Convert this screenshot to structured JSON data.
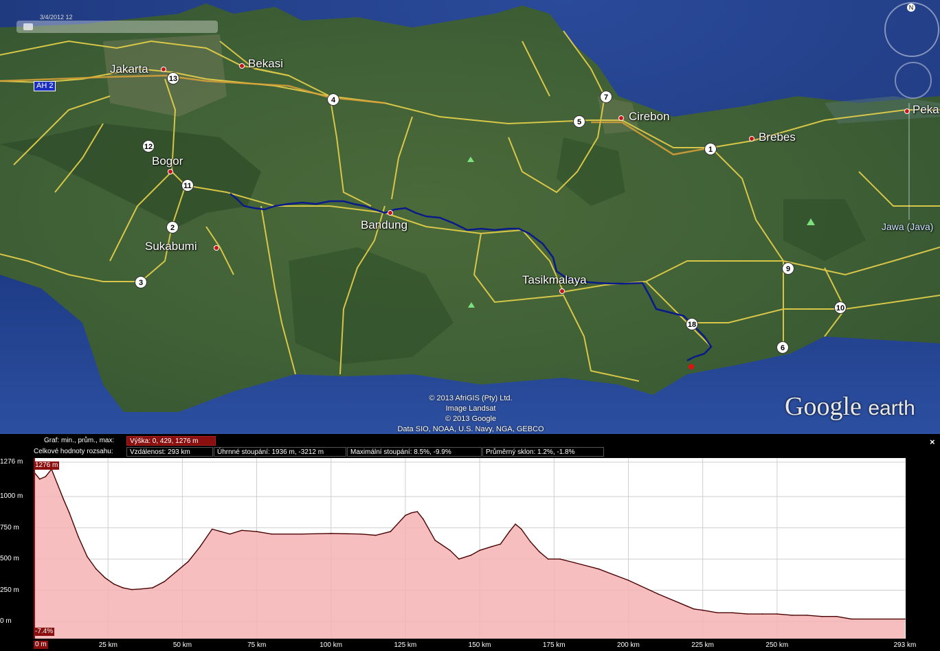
{
  "map": {
    "time_slider_label": "3/4/2012 12",
    "cities": [
      {
        "name": "Jakarta"
      },
      {
        "name": "Bekasi"
      },
      {
        "name": "Bogor"
      },
      {
        "name": "Sukabumi"
      },
      {
        "name": "Bandung"
      },
      {
        "name": "Tasikmalaya"
      },
      {
        "name": "Cirebon"
      },
      {
        "name": "Brebes"
      },
      {
        "name": "Peka"
      },
      {
        "name": "Jawa (Java)"
      }
    ],
    "road_shields": [
      "13",
      "4",
      "12",
      "11",
      "2",
      "3",
      "7",
      "5",
      "1",
      "9",
      "10",
      "18",
      "6"
    ],
    "highway_label": "AH 2",
    "copyright_lines": [
      "© 2013 AfriGIS (Pty) Ltd.",
      "Image Landsat",
      "© 2013 Google",
      "Data SIO, NOAA, U.S. Navy, NGA, GEBCO"
    ],
    "logo_text": "Google",
    "logo_suffix": "earth",
    "compass_label": "N",
    "colors": {
      "route": "#0a1a8a",
      "roads": "#e8d24a",
      "end_marker": "#e01010"
    }
  },
  "panel": {
    "graph_label": "Graf: min., prům., max:",
    "height_stats": "Výška: 0, 429, 1276 m",
    "range_label": "Celkové hodnoty rozsahu:",
    "distance": "Vzdálenost: 293 km",
    "total_climb": "Úhrnné stoupání: 1936 m, -3212 m",
    "max_slope": "Maximální stoupání: 8.5%, -9.9%",
    "avg_slope": "Průměrný sklon: 1.2%, -1.8%",
    "close_label": "×",
    "cursor_value_label": "1276 m",
    "cursor_slope_label": "-7.4%",
    "cursor_distance_label": "0 m"
  },
  "chart_data": {
    "type": "area",
    "xlabel": "",
    "ylabel": "",
    "x_unit": "km",
    "y_unit": "m",
    "xlim": [
      0,
      293
    ],
    "ylim": [
      0,
      1276
    ],
    "x_ticks": [
      "25 km",
      "50 km",
      "75 km",
      "100 km",
      "125 km",
      "150 km",
      "175 km",
      "200 km",
      "225 km",
      "250 km",
      "293 km"
    ],
    "y_ticks": [
      "1276 m",
      "1000 m",
      "750 m",
      "500 m",
      "250 m",
      "0 m"
    ],
    "series": [
      {
        "x": [
          0,
          2,
          4,
          6,
          8,
          10,
          12,
          15,
          18,
          21,
          24,
          27,
          30,
          33,
          36,
          40,
          44,
          48,
          52,
          56,
          60,
          63,
          66,
          70,
          75,
          80,
          90,
          100,
          110,
          115,
          120,
          125,
          127,
          129,
          131,
          135,
          140,
          143,
          147,
          150,
          154,
          157,
          160,
          162,
          164,
          167,
          170,
          173,
          177,
          182,
          190,
          200,
          210,
          220,
          222,
          225,
          230,
          235,
          240,
          245,
          250,
          255,
          260,
          265,
          270,
          275,
          293
        ],
        "y": [
          1200,
          1140,
          1160,
          1220,
          1100,
          980,
          870,
          680,
          520,
          420,
          350,
          300,
          270,
          255,
          260,
          270,
          320,
          400,
          480,
          600,
          740,
          720,
          700,
          730,
          720,
          700,
          700,
          705,
          700,
          690,
          720,
          850,
          870,
          880,
          820,
          650,
          570,
          500,
          530,
          570,
          600,
          620,
          720,
          780,
          740,
          640,
          560,
          500,
          500,
          470,
          420,
          330,
          220,
          120,
          100,
          90,
          70,
          70,
          60,
          60,
          60,
          50,
          50,
          40,
          40,
          20,
          20
        ]
      }
    ],
    "grid": true,
    "colors": {
      "fill": "#f4b3b3",
      "line": "#4a0000"
    }
  }
}
